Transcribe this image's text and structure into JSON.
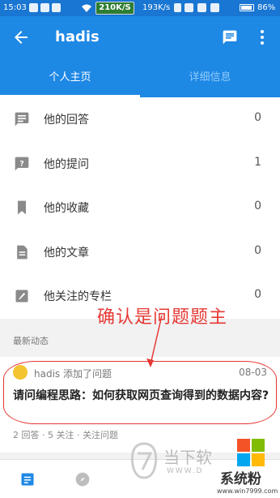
{
  "status_bar": {
    "time": "15:03",
    "speed_badge": "210K/S",
    "net_speed": "193K/s",
    "battery": "86%"
  },
  "app_bar": {
    "title": "hadis"
  },
  "tabs": [
    {
      "label": "个人主页",
      "active": true
    },
    {
      "label": "详细信息",
      "active": false
    }
  ],
  "menu": [
    {
      "label": "他的回答",
      "count": "0",
      "icon": "answer-icon"
    },
    {
      "label": "他的提问",
      "count": "1",
      "icon": "question-icon"
    },
    {
      "label": "他的收藏",
      "count": "0",
      "icon": "bookmark-icon"
    },
    {
      "label": "他的文章",
      "count": "0",
      "icon": "article-icon"
    },
    {
      "label": "他关注的专栏",
      "count": "0",
      "icon": "column-icon"
    }
  ],
  "feed": {
    "section_title": "最新动态",
    "item": {
      "author_action": "hadis 添加了问题",
      "date": "08-03",
      "question": "请问编程思路：如何获取网页查询得到的数据内容?",
      "meta": "2 回答 · 5 关注 · 关注问题"
    }
  },
  "annotation": "确认是问题题主",
  "watermark": {
    "text1": "当下软",
    "text2": "WWW.D",
    "brand": "系统粉",
    "url": "www.win7999.com"
  },
  "colors": {
    "primary": "#1e88e5",
    "status_bar": "#1976d2",
    "annotation": "#e53935"
  }
}
